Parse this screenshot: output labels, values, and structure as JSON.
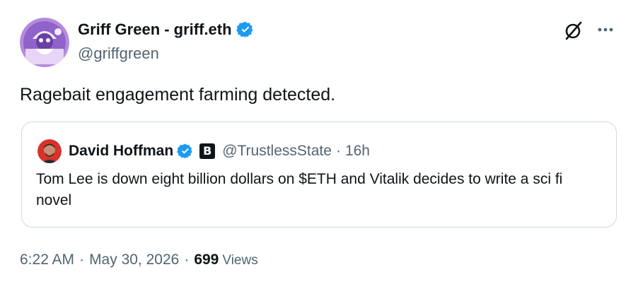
{
  "author": {
    "name": "Griff Green - griff.eth",
    "handle": "@griffgreen"
  },
  "tweet": {
    "text": "Ragebait engagement farming detected."
  },
  "quote": {
    "name": "David Hoffman",
    "affiliate_badge": "B",
    "handle": "@TrustlessState",
    "separator": "·",
    "time": "16h",
    "text": "Tom Lee is down eight billion dollars on $ETH and Vitalik decides to write a sci fi novel"
  },
  "meta": {
    "time": "6:22 AM",
    "date": "May 30, 2026",
    "separator": "·",
    "views_count": "699",
    "views_label": "Views"
  },
  "icons": {
    "verified": "verified-badge-icon",
    "grok": "grok-icon",
    "more": "more-dots-icon"
  },
  "colors": {
    "accent": "#1d9bf0",
    "text": "#0f1419",
    "secondary": "#536471",
    "border": "#cfd9de"
  }
}
